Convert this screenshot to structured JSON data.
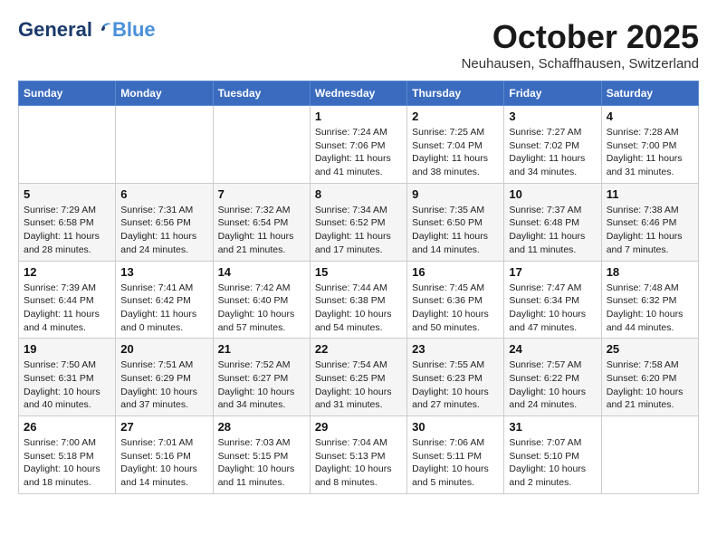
{
  "header": {
    "logo_general": "General",
    "logo_blue": "Blue",
    "month_title": "October 2025",
    "location": "Neuhausen, Schaffhausen, Switzerland"
  },
  "weekdays": [
    "Sunday",
    "Monday",
    "Tuesday",
    "Wednesday",
    "Thursday",
    "Friday",
    "Saturday"
  ],
  "weeks": [
    {
      "days": [
        {
          "num": "",
          "info": ""
        },
        {
          "num": "",
          "info": ""
        },
        {
          "num": "",
          "info": ""
        },
        {
          "num": "1",
          "info": "Sunrise: 7:24 AM\nSunset: 7:06 PM\nDaylight: 11 hours\nand 41 minutes."
        },
        {
          "num": "2",
          "info": "Sunrise: 7:25 AM\nSunset: 7:04 PM\nDaylight: 11 hours\nand 38 minutes."
        },
        {
          "num": "3",
          "info": "Sunrise: 7:27 AM\nSunset: 7:02 PM\nDaylight: 11 hours\nand 34 minutes."
        },
        {
          "num": "4",
          "info": "Sunrise: 7:28 AM\nSunset: 7:00 PM\nDaylight: 11 hours\nand 31 minutes."
        }
      ]
    },
    {
      "days": [
        {
          "num": "5",
          "info": "Sunrise: 7:29 AM\nSunset: 6:58 PM\nDaylight: 11 hours\nand 28 minutes."
        },
        {
          "num": "6",
          "info": "Sunrise: 7:31 AM\nSunset: 6:56 PM\nDaylight: 11 hours\nand 24 minutes."
        },
        {
          "num": "7",
          "info": "Sunrise: 7:32 AM\nSunset: 6:54 PM\nDaylight: 11 hours\nand 21 minutes."
        },
        {
          "num": "8",
          "info": "Sunrise: 7:34 AM\nSunset: 6:52 PM\nDaylight: 11 hours\nand 17 minutes."
        },
        {
          "num": "9",
          "info": "Sunrise: 7:35 AM\nSunset: 6:50 PM\nDaylight: 11 hours\nand 14 minutes."
        },
        {
          "num": "10",
          "info": "Sunrise: 7:37 AM\nSunset: 6:48 PM\nDaylight: 11 hours\nand 11 minutes."
        },
        {
          "num": "11",
          "info": "Sunrise: 7:38 AM\nSunset: 6:46 PM\nDaylight: 11 hours\nand 7 minutes."
        }
      ]
    },
    {
      "days": [
        {
          "num": "12",
          "info": "Sunrise: 7:39 AM\nSunset: 6:44 PM\nDaylight: 11 hours\nand 4 minutes."
        },
        {
          "num": "13",
          "info": "Sunrise: 7:41 AM\nSunset: 6:42 PM\nDaylight: 11 hours\nand 0 minutes."
        },
        {
          "num": "14",
          "info": "Sunrise: 7:42 AM\nSunset: 6:40 PM\nDaylight: 10 hours\nand 57 minutes."
        },
        {
          "num": "15",
          "info": "Sunrise: 7:44 AM\nSunset: 6:38 PM\nDaylight: 10 hours\nand 54 minutes."
        },
        {
          "num": "16",
          "info": "Sunrise: 7:45 AM\nSunset: 6:36 PM\nDaylight: 10 hours\nand 50 minutes."
        },
        {
          "num": "17",
          "info": "Sunrise: 7:47 AM\nSunset: 6:34 PM\nDaylight: 10 hours\nand 47 minutes."
        },
        {
          "num": "18",
          "info": "Sunrise: 7:48 AM\nSunset: 6:32 PM\nDaylight: 10 hours\nand 44 minutes."
        }
      ]
    },
    {
      "days": [
        {
          "num": "19",
          "info": "Sunrise: 7:50 AM\nSunset: 6:31 PM\nDaylight: 10 hours\nand 40 minutes."
        },
        {
          "num": "20",
          "info": "Sunrise: 7:51 AM\nSunset: 6:29 PM\nDaylight: 10 hours\nand 37 minutes."
        },
        {
          "num": "21",
          "info": "Sunrise: 7:52 AM\nSunset: 6:27 PM\nDaylight: 10 hours\nand 34 minutes."
        },
        {
          "num": "22",
          "info": "Sunrise: 7:54 AM\nSunset: 6:25 PM\nDaylight: 10 hours\nand 31 minutes."
        },
        {
          "num": "23",
          "info": "Sunrise: 7:55 AM\nSunset: 6:23 PM\nDaylight: 10 hours\nand 27 minutes."
        },
        {
          "num": "24",
          "info": "Sunrise: 7:57 AM\nSunset: 6:22 PM\nDaylight: 10 hours\nand 24 minutes."
        },
        {
          "num": "25",
          "info": "Sunrise: 7:58 AM\nSunset: 6:20 PM\nDaylight: 10 hours\nand 21 minutes."
        }
      ]
    },
    {
      "days": [
        {
          "num": "26",
          "info": "Sunrise: 7:00 AM\nSunset: 5:18 PM\nDaylight: 10 hours\nand 18 minutes."
        },
        {
          "num": "27",
          "info": "Sunrise: 7:01 AM\nSunset: 5:16 PM\nDaylight: 10 hours\nand 14 minutes."
        },
        {
          "num": "28",
          "info": "Sunrise: 7:03 AM\nSunset: 5:15 PM\nDaylight: 10 hours\nand 11 minutes."
        },
        {
          "num": "29",
          "info": "Sunrise: 7:04 AM\nSunset: 5:13 PM\nDaylight: 10 hours\nand 8 minutes."
        },
        {
          "num": "30",
          "info": "Sunrise: 7:06 AM\nSunset: 5:11 PM\nDaylight: 10 hours\nand 5 minutes."
        },
        {
          "num": "31",
          "info": "Sunrise: 7:07 AM\nSunset: 5:10 PM\nDaylight: 10 hours\nand 2 minutes."
        },
        {
          "num": "",
          "info": ""
        }
      ]
    }
  ]
}
